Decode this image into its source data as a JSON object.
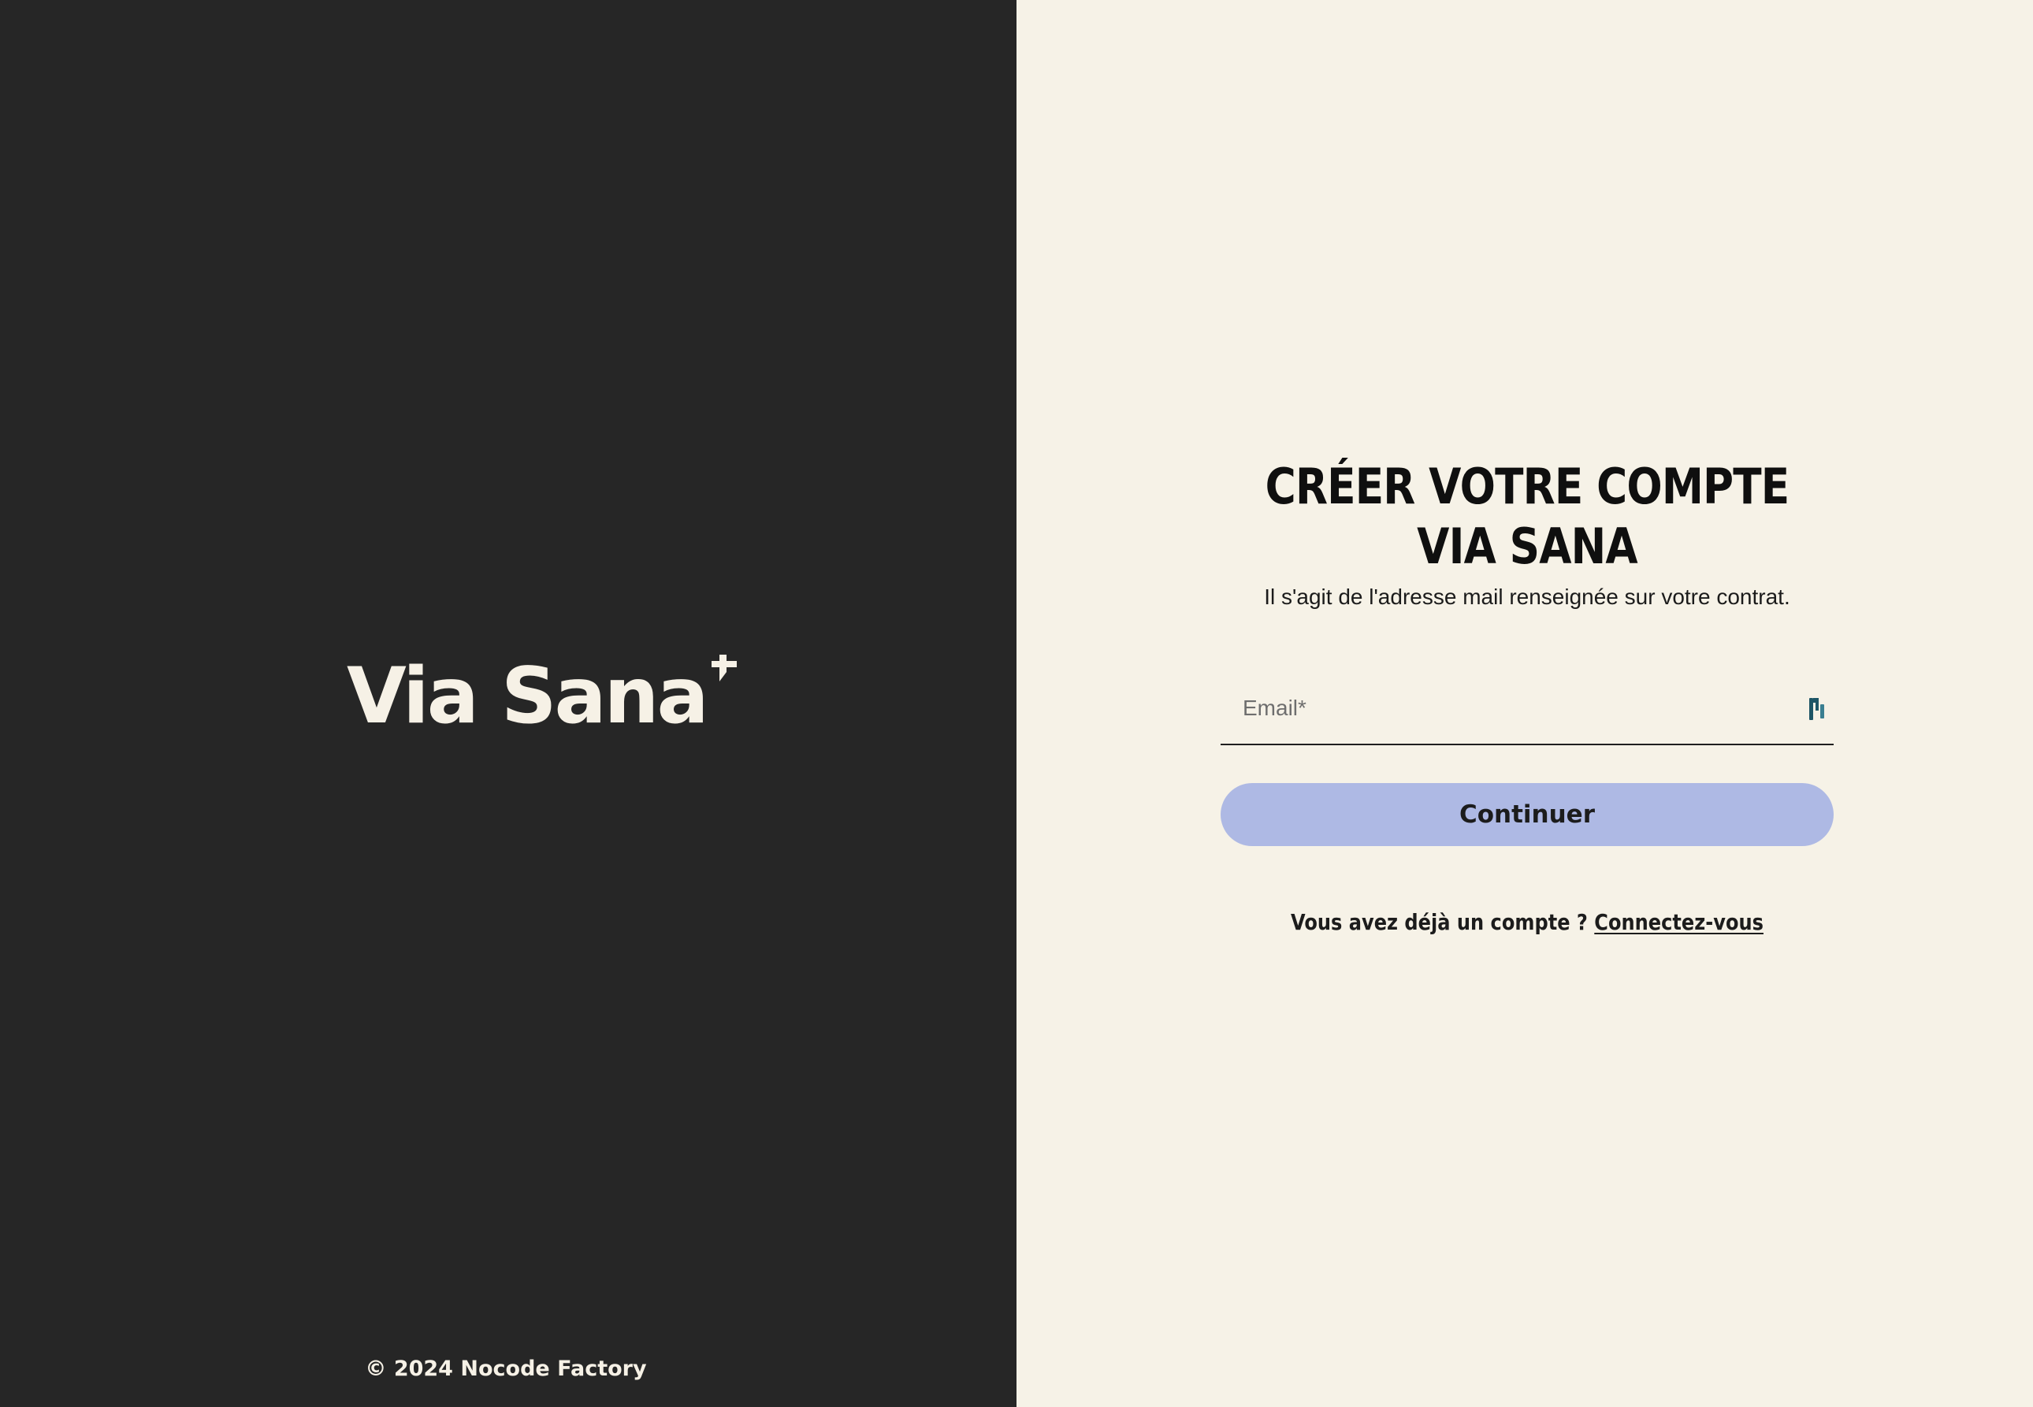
{
  "brand": {
    "name": "Via Sana",
    "copyright": "© 2024 Nocode Factory",
    "colors": {
      "dark_panel": "#262626",
      "light_panel": "#f6f2e7",
      "button": "#aeb9e4",
      "logo_text": "#f6f1e6"
    }
  },
  "form": {
    "title": "CRÉER VOTRE COMPTE VIA SANA",
    "subtitle": "Il s'agit de l'adresse mail renseignée sur votre contrat.",
    "email_placeholder": "Email*",
    "email_value": "",
    "password_manager_icon": "password-manager-icon",
    "continue_label": "Continuer",
    "login_prompt": "Vous avez déjà un compte ?",
    "login_link": "Connectez-vous"
  }
}
